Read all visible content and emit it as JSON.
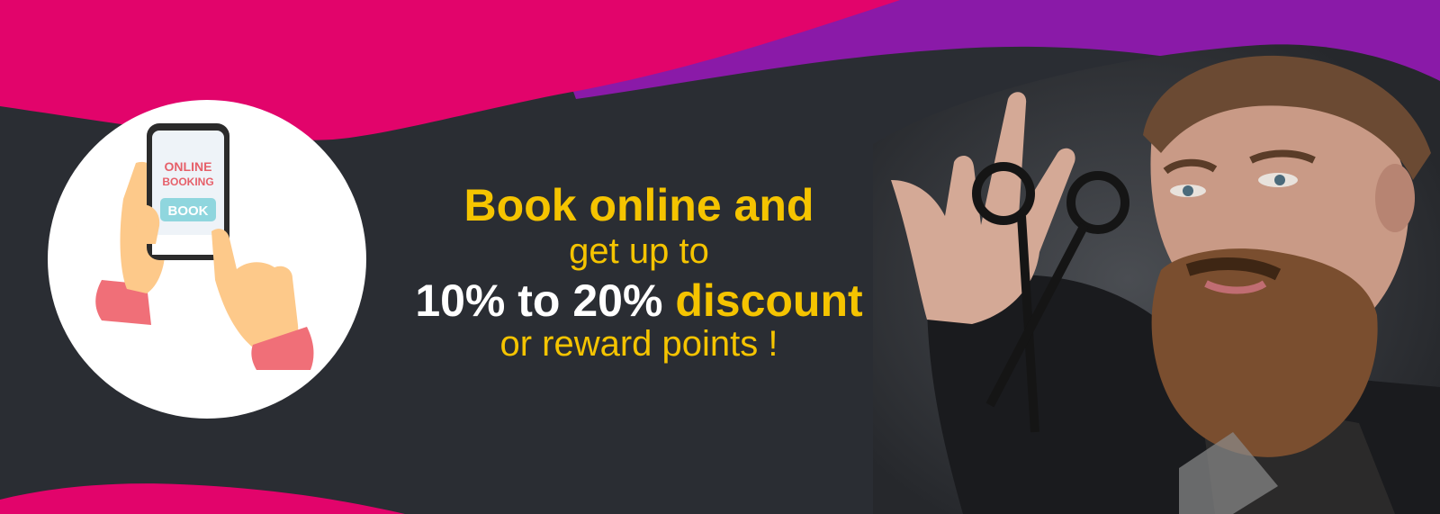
{
  "banner": {
    "colors": {
      "background": "#2a2d33",
      "pink": "#e2046b",
      "purple": "#8a1aa8",
      "accent_yellow": "#f5c400",
      "white": "#ffffff"
    },
    "illustration": {
      "icon": "phone-booking-icon",
      "screen_title_line1": "ONLINE",
      "screen_title_line2": "BOOKING",
      "button_label": "BOOK"
    },
    "headline": {
      "line1": "Book online and",
      "line2": "get up to",
      "line3_white": "10% to 20%",
      "line3_yellow": "discount",
      "line4": "or reward points !"
    },
    "photo": {
      "subject": "bearded-barber-with-scissors-photo"
    }
  }
}
